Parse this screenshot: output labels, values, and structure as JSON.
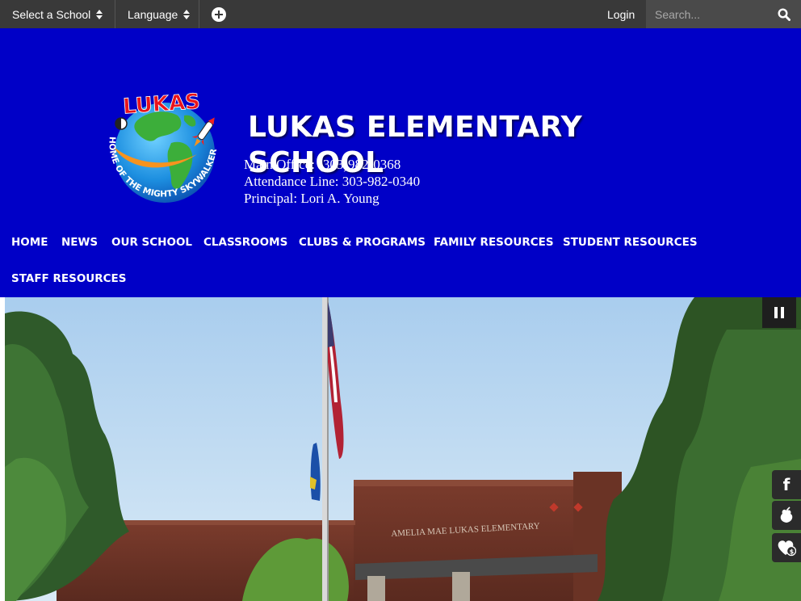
{
  "topbar": {
    "select_school": "Select a School",
    "language": "Language",
    "login": "Login",
    "search_placeholder": "Search..."
  },
  "header": {
    "logo_text_top": "LUKAS",
    "logo_text_ring": "HOME OF THE MIGHTY SKYWALKERS",
    "title_line1": "LUKAS ELEMENTARY",
    "title_line2": "SCHOOL",
    "main_office": "Main Office: (303)982-0368",
    "attendance_line": "Attendance Line: 303-982-0340",
    "principal": "Principal: Lori A. Young"
  },
  "nav": {
    "items": [
      "HOME",
      "NEWS",
      "OUR SCHOOL",
      "CLASSROOMS",
      "CLUBS & PROGRAMS",
      "FAMILY RESOURCES",
      "STUDENT RESOURCES",
      "STAFF RESOURCES"
    ]
  },
  "hero": {
    "building_sign": "AMELIA MAE LUKAS ELEMENTARY"
  },
  "social": {
    "facebook_letter": "f",
    "peachjar_icon": "peachjar-icon",
    "donate_icon": "heart-dollar-icon"
  },
  "colors": {
    "topbar": "#393939",
    "header_bg": "#0000c7",
    "sky": "#b9d8f0"
  }
}
